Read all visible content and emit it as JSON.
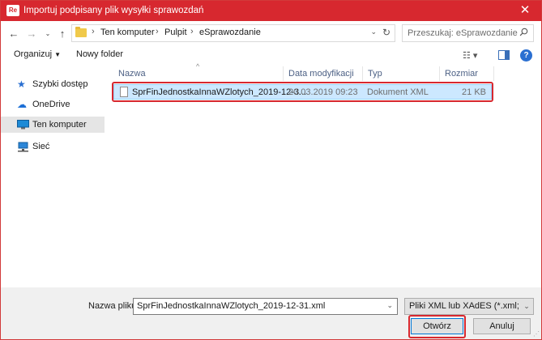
{
  "window": {
    "title": "Importuj podpisany plik wysyłki sprawozdań",
    "app_icon": "Re",
    "close_label": "✕"
  },
  "address": {
    "breadcrumbs": [
      "Ten komputer",
      "Pulpit",
      "eSprawozdanie"
    ],
    "search_placeholder": "Przeszukaj: eSprawozdanie"
  },
  "toolbar": {
    "organize_label": "Organizuj",
    "new_folder_label": "Nowy folder",
    "help_label": "?"
  },
  "sidebar": {
    "items": [
      {
        "label": "Szybki dostęp",
        "icon": "star-icon"
      },
      {
        "label": "OneDrive",
        "icon": "cloud-icon"
      },
      {
        "label": "Ten komputer",
        "icon": "computer-icon",
        "selected": true
      },
      {
        "label": "Sieć",
        "icon": "network-icon"
      }
    ]
  },
  "file_list": {
    "columns": [
      "Nazwa",
      "Data modyfikacji",
      "Typ",
      "Rozmiar"
    ],
    "rows": [
      {
        "name": "SprFinJednostkaInnaWZlotych_2019-12-3...",
        "modified": "20.03.2019 09:23",
        "type": "Dokument XML",
        "size": "21 KB",
        "selected": true
      }
    ]
  },
  "footer": {
    "filename_label": "Nazwa pliku:",
    "filename_value": "SprFinJednostkaInnaWZlotych_2019-12-31.xml",
    "filetype_value": "Pliki XML lub XAdES (*.xml; *.Xa",
    "open_label": "Otwórz",
    "cancel_label": "Anuluj"
  },
  "colors": {
    "accent": "#d7282f",
    "selection_bg": "#cce8ff",
    "selection_border": "#99d1ff",
    "link": "#2a6fd1"
  }
}
